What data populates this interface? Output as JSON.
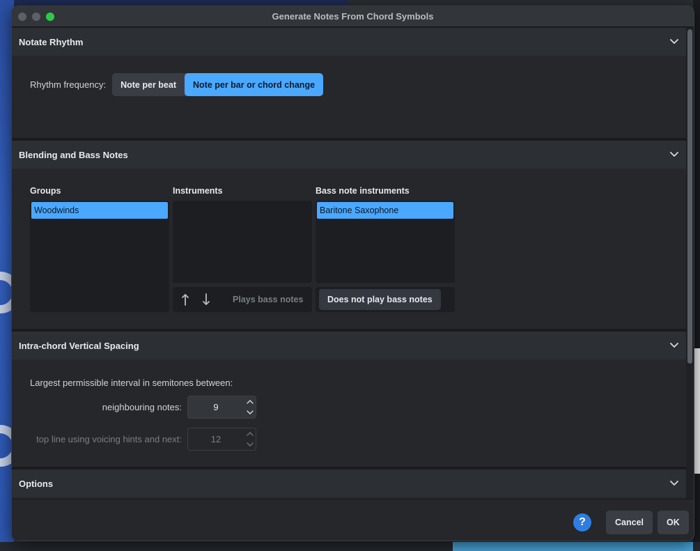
{
  "window": {
    "title": "Generate Notes From Chord Symbols"
  },
  "sections": {
    "rhythm": {
      "title": "Notate Rhythm",
      "frequency_label": "Rhythm frequency:",
      "option_beat": "Note per beat",
      "option_bar": "Note per bar or chord change",
      "selected": "Note per bar or chord change"
    },
    "blending": {
      "title": "Blending and Bass Notes",
      "groups_label": "Groups",
      "groups": [
        "Woodwinds"
      ],
      "instruments_label": "Instruments",
      "instruments": [],
      "bass_label": "Bass note instruments",
      "bass_instruments": [
        "Baritone Saxophone"
      ],
      "plays_bass_label": "Plays bass notes",
      "not_plays_bass_label": "Does not play bass notes"
    },
    "spacing": {
      "title": "Intra-chord Vertical Spacing",
      "intro": "Largest permissible interval in semitones between:",
      "neighbouring_label": "neighbouring notes:",
      "neighbouring_value": "9",
      "topline_label": "top line using voicing hints and next:",
      "topline_value": "12"
    },
    "options": {
      "title": "Options"
    }
  },
  "footer": {
    "help_label": "?",
    "cancel_label": "Cancel",
    "ok_label": "OK"
  },
  "colors": {
    "accent": "#4aa8ff",
    "help": "#2f7de0",
    "window_bg": "#1f2124",
    "header_bg": "#2c2f34"
  }
}
